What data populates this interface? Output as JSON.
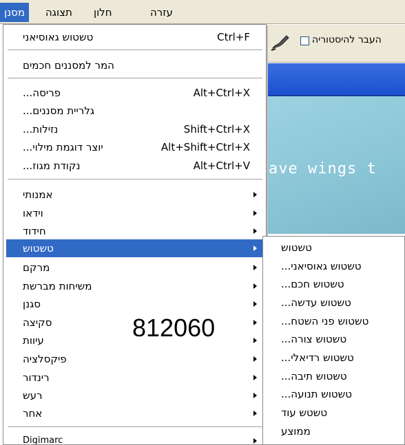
{
  "menubar": {
    "items": [
      {
        "label": "עזרה"
      },
      {
        "label": "חלון"
      },
      {
        "label": "תצוגה"
      },
      {
        "label": "מסנן",
        "active": true
      }
    ]
  },
  "toolbar": {
    "history_checkbox_label": "העבר להיסטוריה",
    "history_checked": false,
    "brush_icon": "brush-icon"
  },
  "canvas": {
    "text": "ave wings t"
  },
  "filter_menu": {
    "last_filter": {
      "label": "טשטוש גאוסיאני",
      "shortcut": "Ctrl+F"
    },
    "convert_smart": {
      "label": "המר למסננים חכמים"
    },
    "group1": [
      {
        "label": "פריסה...",
        "shortcut": "Alt+Ctrl+X"
      },
      {
        "label": "גלריית מסננים...",
        "shortcut": ""
      },
      {
        "label": "נזילות...",
        "shortcut": "Shift+Ctrl+X"
      },
      {
        "label": "יוצר דוגמת מילוי...",
        "shortcut": "Alt+Shift+Ctrl+X"
      },
      {
        "label": "נקודת מגוז...",
        "shortcut": "Alt+Ctrl+V"
      }
    ],
    "submenus": [
      {
        "label": "אמנותי"
      },
      {
        "label": "וידאו"
      },
      {
        "label": "חידוד"
      },
      {
        "label": "טשטוש",
        "highlighted": true
      },
      {
        "label": "מרקם"
      },
      {
        "label": "משיחות מברשת"
      },
      {
        "label": "סגנן"
      },
      {
        "label": "סקיצה"
      },
      {
        "label": "עיוות"
      },
      {
        "label": "פיקסלציה"
      },
      {
        "label": "רינדור"
      },
      {
        "label": "רעש"
      },
      {
        "label": "אחר"
      }
    ],
    "plugins": [
      {
        "label": "Digimarc"
      }
    ]
  },
  "blur_submenu": {
    "items": [
      {
        "label": "טשטוש"
      },
      {
        "label": "טשטוש גאוסיאני..."
      },
      {
        "label": "טשטוש חכם..."
      },
      {
        "label": "טשטוש עדשה..."
      },
      {
        "label": "טשטוש פני השטח..."
      },
      {
        "label": "טשטוש צורה..."
      },
      {
        "label": "טשטוש רדיאלי..."
      },
      {
        "label": "טשטוש תיבה..."
      },
      {
        "label": "טשטוש תנועה..."
      },
      {
        "label": "טשטש עוד"
      },
      {
        "label": "ממוצע"
      }
    ]
  },
  "overlay_number": "812060",
  "colors": {
    "menubar_bg": "#ece9d8",
    "highlight": "#316ac5",
    "canvas_bg": "#8bc6d7"
  }
}
